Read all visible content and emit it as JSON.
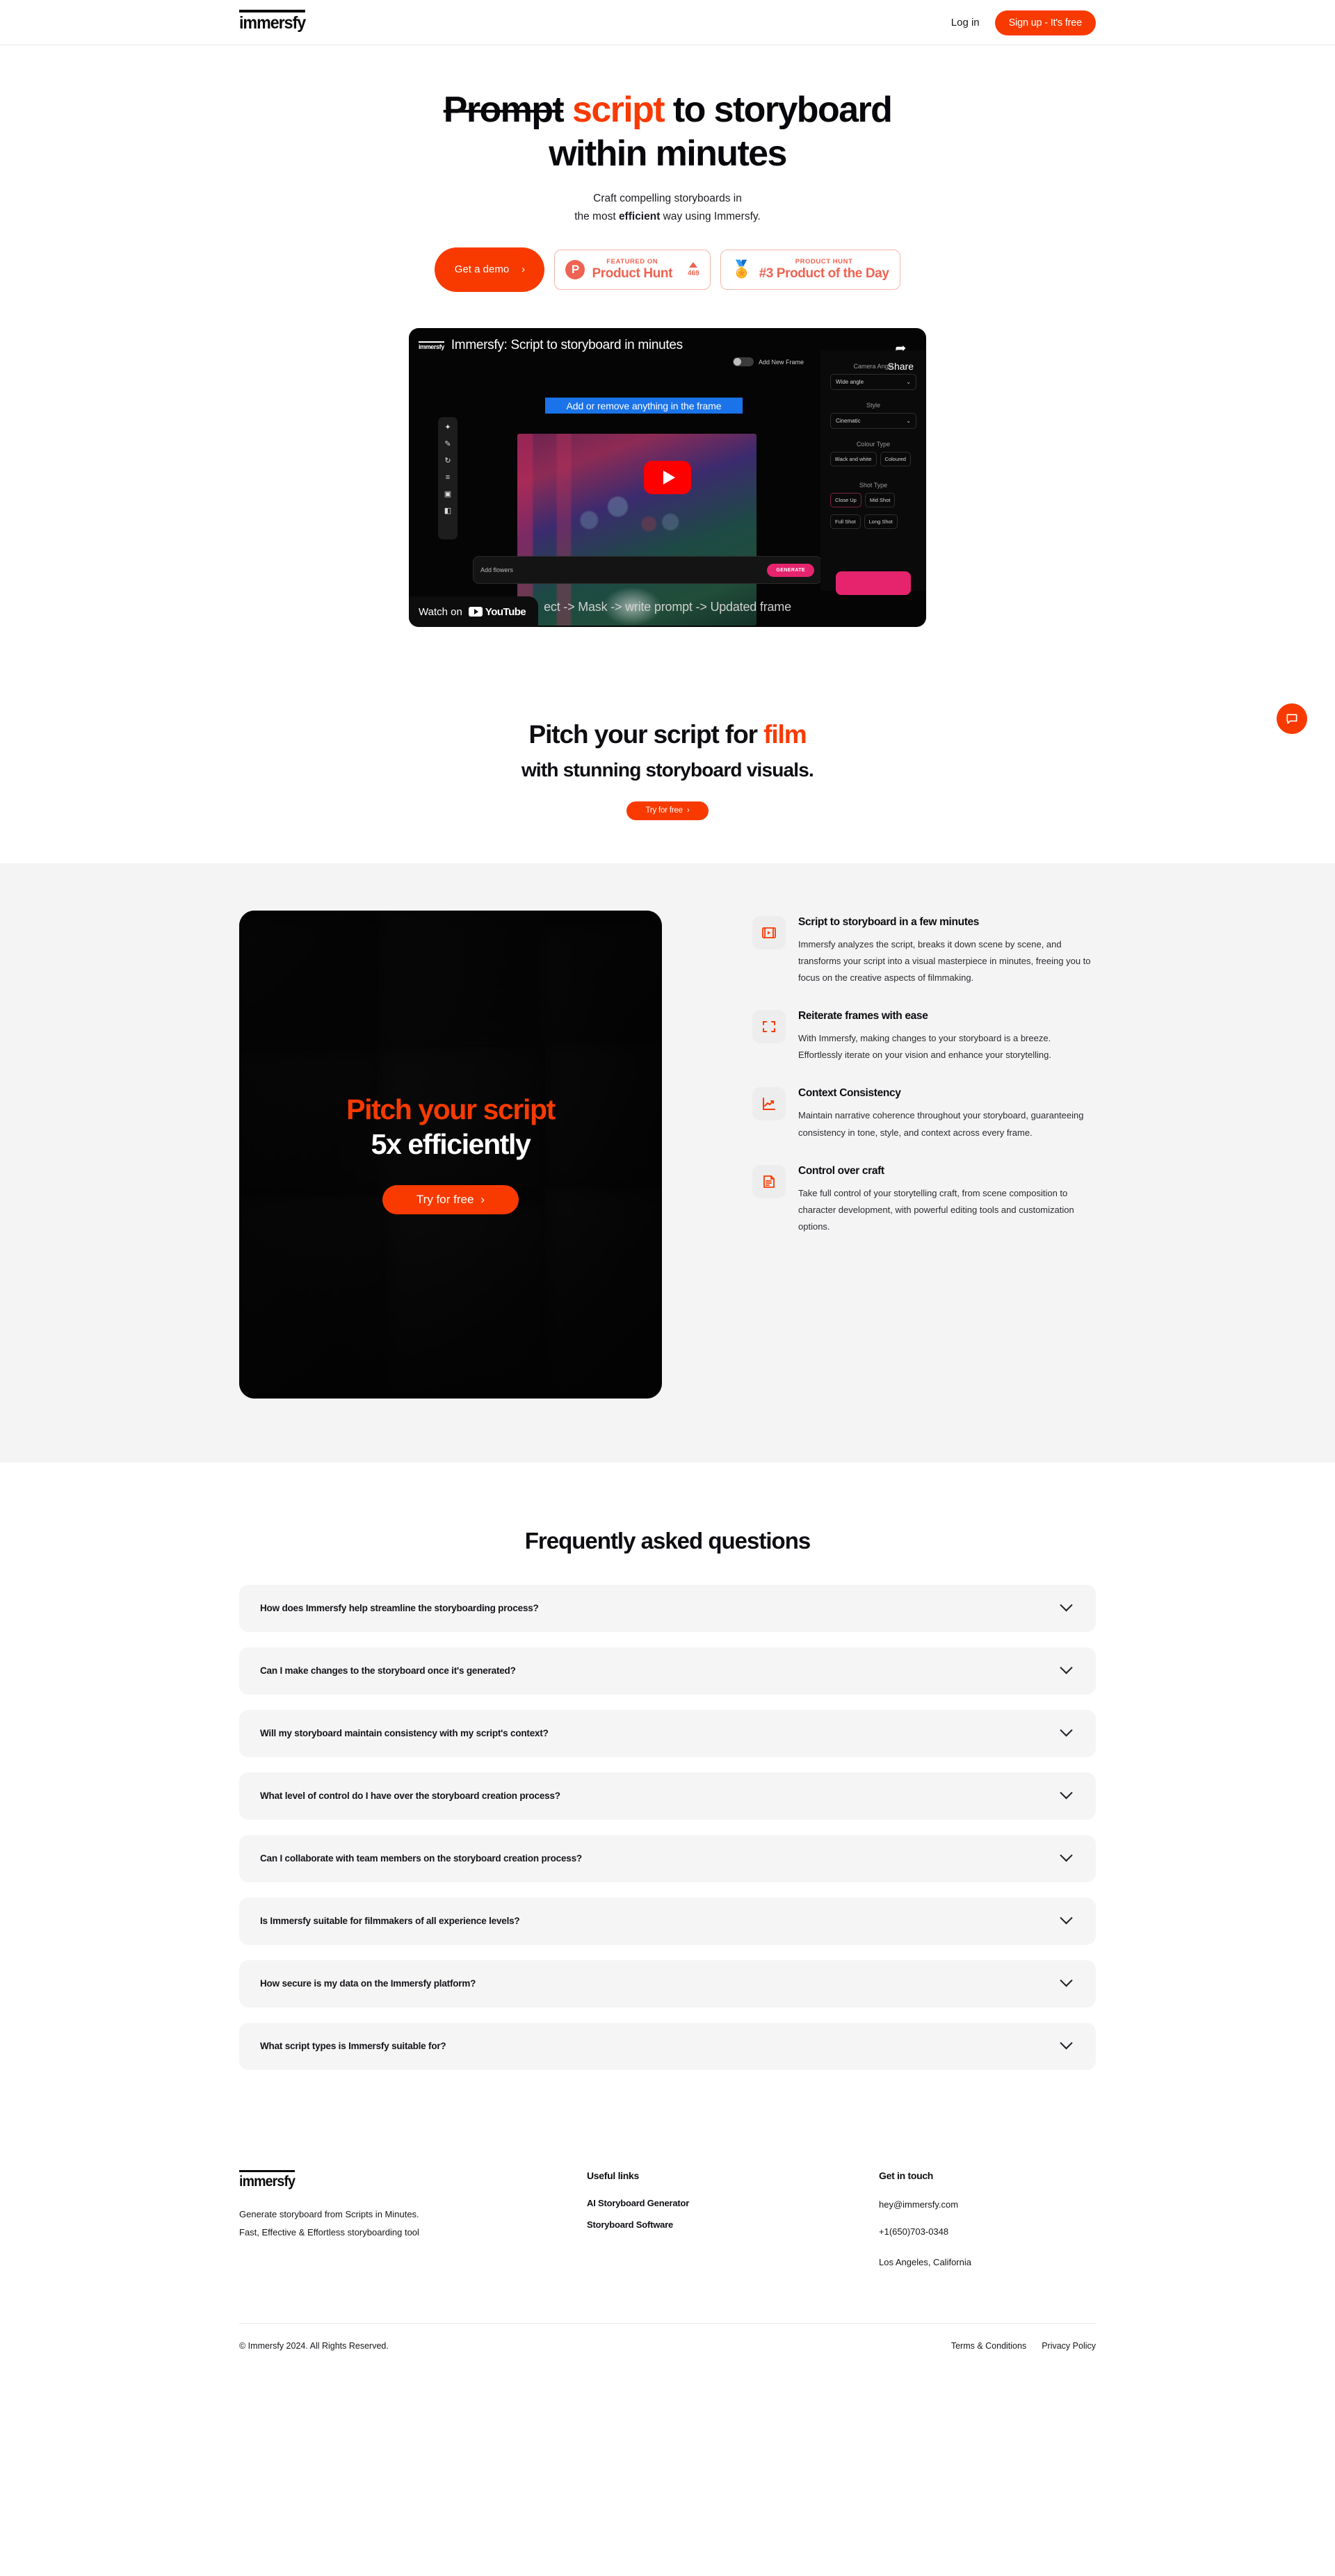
{
  "nav": {
    "logo": "immersfy",
    "login": "Log in",
    "signup": "Sign up - It's free"
  },
  "hero": {
    "title_strike": "Prompt",
    "title_red": "script",
    "title_rest_1": "to",
    "title_line2": "storyboard within",
    "title_line3": "minutes",
    "sub_line1": "Craft compelling storyboards in",
    "sub_line2_a": "the most ",
    "sub_line2_b": "efficient",
    "sub_line2_c": " way using Immersfy.",
    "demo_button": "Get a demo",
    "demo_chevron": "›",
    "badge_featured": {
      "mark": "P",
      "kicker": "FEATURED ON",
      "title": "Product Hunt",
      "votes": "469"
    },
    "badge_pod": {
      "medal": "🏅",
      "kicker": "PRODUCT HUNT",
      "title": "#3 Product of the Day"
    }
  },
  "video": {
    "brand": "immersfy",
    "title": "Immersfy: Script to storyboard in minutes",
    "share_label": "Share",
    "share_icon": "➦",
    "toggle_label": "Add New Frame",
    "selection_banner": "Add or remove anything in the frame",
    "tools": [
      "✂",
      "✎",
      "↻",
      "≡",
      "▣",
      "◧"
    ],
    "prompt_placeholder": "Add flowers",
    "generate_label": "GENERATE",
    "caption": "ect -> Mask -> write prompt -> Updated frame",
    "panel": {
      "camera_angle_label": "Camera Angle",
      "camera_angle_value": "Wide angle",
      "style_label": "Style",
      "style_value": "Cinematic",
      "colour_label": "Colour Type",
      "colour_options": [
        "Black and white",
        "Coloured"
      ],
      "shot_label": "Shot Type",
      "shot_options": [
        "Close Up",
        "Mid Shot",
        "Full Shot",
        "Long Shot"
      ]
    },
    "watch_on": "Watch on",
    "youtube": "YouTube"
  },
  "pitch": {
    "line1_a": "Pitch your script for ",
    "line1_b": "film",
    "line2": "with stunning storyboard visuals.",
    "cta": "Try for free",
    "cta_chevron": "›"
  },
  "promo": {
    "line1": "Pitch your script",
    "line2": "5x efficiently",
    "cta": "Try for free",
    "cta_chevron": "›"
  },
  "features": [
    {
      "icon": "film-strip-play-icon",
      "title": "Script to storyboard in a few minutes",
      "body": "Immersfy analyzes the script, breaks it down scene by scene, and transforms your script into a visual masterpiece in minutes, freeing you to focus on the creative aspects of filmmaking."
    },
    {
      "icon": "expand-corners-icon",
      "title": "Reiterate frames with ease",
      "body": "With Immersfy, making changes to your storyboard is a breeze. Effortlessly iterate on your vision and enhance your storytelling."
    },
    {
      "icon": "trend-chart-icon",
      "title": "Context Consistency",
      "body": "Maintain narrative coherence throughout your storyboard, guaranteeing consistency in tone, style, and context across every frame."
    },
    {
      "icon": "document-lines-icon",
      "title": "Control over craft",
      "body": "Take full control of your storytelling craft, from scene composition to character development, with powerful editing tools and customization options."
    }
  ],
  "faq": {
    "heading": "Frequently asked questions",
    "items": [
      "How does Immersfy help streamline the storyboarding process?",
      "Can I make changes to the storyboard once it's generated?",
      "Will my storyboard maintain consistency with my script's context?",
      "What level of control do I have over the storyboard creation process?",
      "Can I collaborate with team members on the storyboard creation process?",
      "Is Immersfy suitable for filmmakers of all experience levels?",
      "How secure is my data on the Immersfy platform?",
      "What script types is Immersfy suitable for?"
    ]
  },
  "footer": {
    "logo": "immersfy",
    "desc_line1": "Generate storyboard from Scripts in Minutes.",
    "desc_line2": "Fast, Effective & Effortless storyboarding tool",
    "useful_links_head": "Useful links",
    "useful_links": [
      "AI Storyboard Generator",
      "Storyboard Software"
    ],
    "contact_head": "Get in touch",
    "email": "hey@immersfy.com",
    "phone": "+1(650)703-0348",
    "location": "Los Angeles, California",
    "copyright": "© Immersfy 2024. All Rights Reserved.",
    "terms": "Terms & Conditions",
    "privacy": "Privacy Policy"
  },
  "chat": {
    "icon": "chat-bubble-icon"
  },
  "colors": {
    "accent": "#f93a00",
    "surface": "#f4f4f4",
    "ink": "#0d0d12"
  }
}
